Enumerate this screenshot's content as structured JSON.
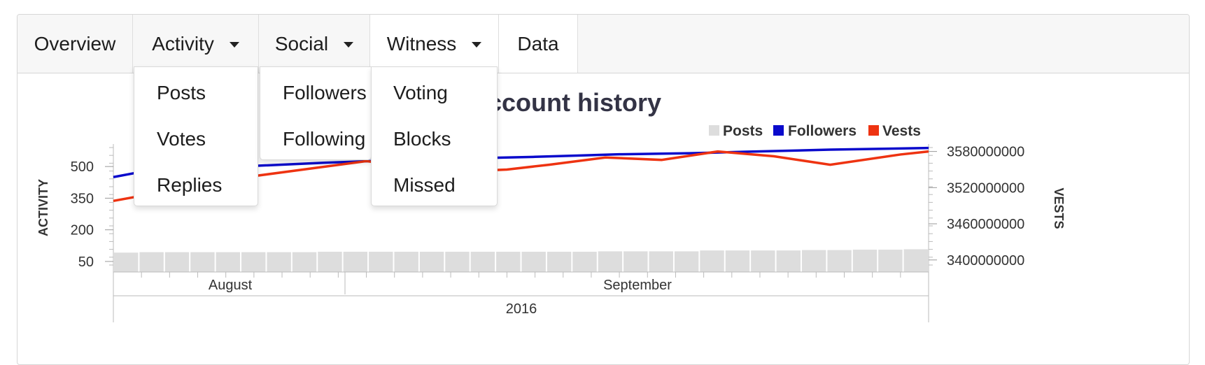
{
  "nav": {
    "tabs": [
      {
        "label": "Overview"
      },
      {
        "label": "Activity"
      },
      {
        "label": "Social"
      },
      {
        "label": "Witness"
      },
      {
        "label": "Data"
      }
    ],
    "activity_menu": [
      "Posts",
      "Votes",
      "Replies"
    ],
    "social_menu": [
      "Followers",
      "Following"
    ],
    "witness_menu": [
      "Voting",
      "Blocks",
      "Missed"
    ]
  },
  "chart_data": {
    "type": "line",
    "title": "Account history",
    "title_visible": "ccount history",
    "legend_position": "top-right",
    "left_axis": {
      "label": "ACTIVITY",
      "ticks": [
        50,
        200,
        350,
        500
      ],
      "range": [
        0,
        600
      ]
    },
    "right_axis": {
      "label": "VESTS",
      "ticks": [
        "3400000000",
        "3460000000",
        "3520000000",
        "3580000000"
      ],
      "range": [
        3380000000,
        3590000000
      ]
    },
    "x_axis": {
      "months": [
        "August",
        "September"
      ],
      "years": [
        "2016"
      ]
    },
    "series": [
      {
        "name": "Posts",
        "type": "bar",
        "axis": "left",
        "color": "#dddddd",
        "values": [
          92,
          94,
          94,
          94,
          94,
          94,
          94,
          94,
          96,
          96,
          96,
          96,
          96,
          96,
          96,
          96,
          96,
          96,
          96,
          98,
          98,
          98,
          98,
          102,
          102,
          102,
          102,
          104,
          104,
          106,
          106,
          108
        ]
      },
      {
        "name": "Followers",
        "type": "line",
        "axis": "left",
        "color": "#0a0acc",
        "points": [
          [
            0,
            450
          ],
          [
            2,
            475
          ],
          [
            5,
            490
          ],
          [
            9,
            500
          ],
          [
            15,
            518
          ],
          [
            20,
            530
          ],
          [
            23,
            535
          ],
          [
            26,
            540
          ],
          [
            30,
            546
          ],
          [
            33,
            552
          ],
          [
            36,
            558
          ],
          [
            41,
            563
          ],
          [
            45,
            570
          ],
          [
            51,
            580
          ],
          [
            58,
            588
          ]
        ]
      },
      {
        "name": "Vests",
        "type": "line",
        "axis": "right",
        "color": "#ee3311",
        "points": [
          [
            0,
            3498000000
          ],
          [
            9,
            3536000000
          ],
          [
            18,
            3564000000
          ],
          [
            24,
            3546000000
          ],
          [
            28,
            3550000000
          ],
          [
            31,
            3558000000
          ],
          [
            35,
            3570000000
          ],
          [
            39,
            3566000000
          ],
          [
            43,
            3580000000
          ],
          [
            47,
            3572000000
          ],
          [
            51,
            3558000000
          ],
          [
            56,
            3575000000
          ],
          [
            58,
            3580000000
          ]
        ],
        "note": "x values are days from the start of the visible range"
      }
    ]
  }
}
